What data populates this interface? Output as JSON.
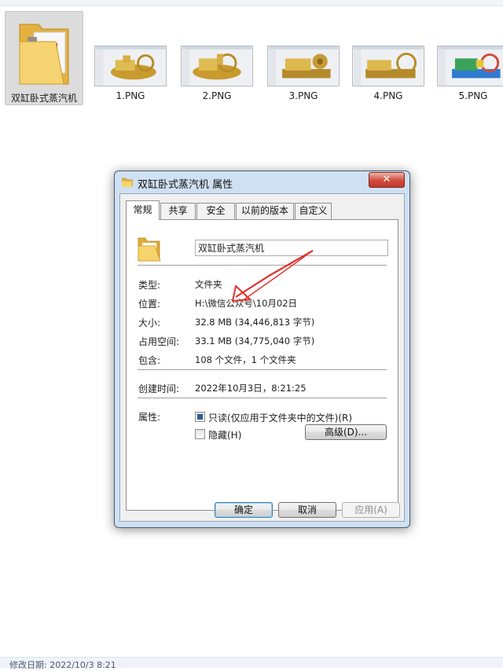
{
  "explorer": {
    "files": [
      {
        "label": "双缸卧式蒸汽机",
        "type": "folder",
        "selected": true
      },
      {
        "label": "1.PNG",
        "type": "image"
      },
      {
        "label": "2.PNG",
        "type": "image"
      },
      {
        "label": "3.PNG",
        "type": "image"
      },
      {
        "label": "4.PNG",
        "type": "image"
      },
      {
        "label": "5.PNG",
        "type": "image"
      }
    ],
    "status_text": "修改日期: 2022/10/3 8:21"
  },
  "dialog": {
    "title": "双缸卧式蒸汽机 属性",
    "close_label": "✕",
    "tabs": [
      {
        "label": "常规",
        "active": true
      },
      {
        "label": "共享"
      },
      {
        "label": "安全"
      },
      {
        "label": "以前的版本"
      },
      {
        "label": "自定义"
      }
    ],
    "name_value": "双缸卧式蒸汽机",
    "properties": [
      {
        "label": "类型:",
        "value": "文件夹"
      },
      {
        "label": "位置:",
        "value": "H:\\微信公众号\\10月02日"
      },
      {
        "label": "大小:",
        "value": "32.8 MB (34,446,813 字节)"
      },
      {
        "label": "占用空间:",
        "value": "33.1 MB (34,775,040 字节)"
      },
      {
        "label": "包含:",
        "value": "108 个文件，1 个文件夹"
      },
      {
        "label": "创建时间:",
        "value": "2022年10月3日，8:21:25"
      },
      {
        "label": "属性:"
      }
    ],
    "attributes": {
      "readonly_label": "只读(仅应用于文件夹中的文件)(R)",
      "readonly_state": "indeterminate",
      "hidden_label": "隐藏(H)",
      "hidden_checked": false,
      "advanced_label": "高级(D)..."
    },
    "buttons": {
      "ok": "确定",
      "cancel": "取消",
      "apply": "应用(A)"
    },
    "annotation_color": "#e0322d"
  },
  "colors": {
    "dialog_frame": "#cfe0f2",
    "folder_yellow": "#f3c95a",
    "engine_gold": "#d8b24a"
  }
}
